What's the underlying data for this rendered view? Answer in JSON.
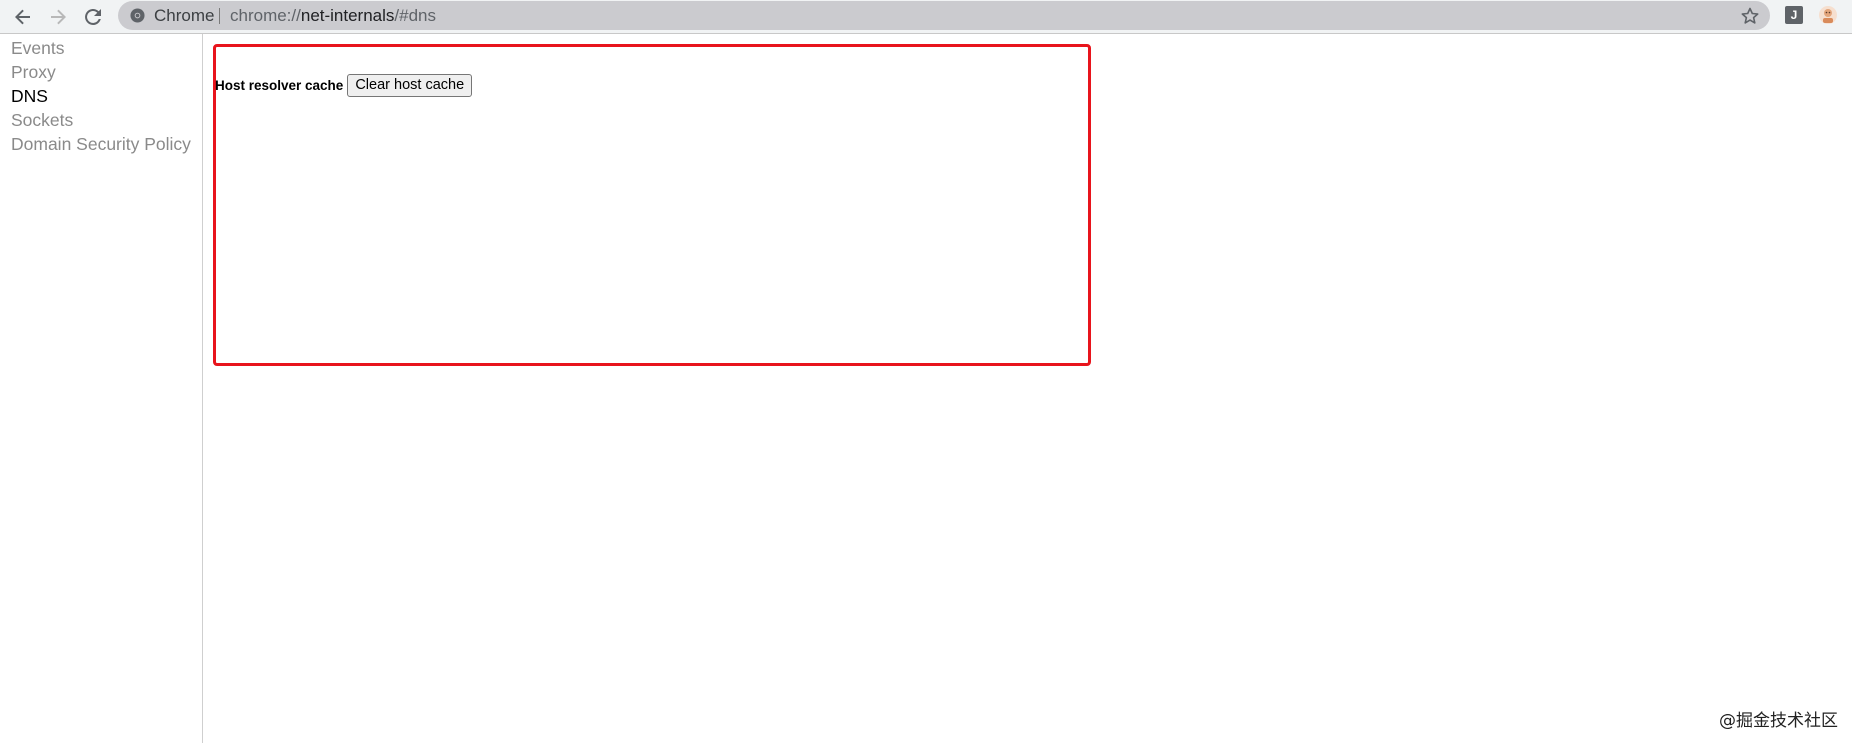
{
  "browser": {
    "site_label": "Chrome",
    "url_scheme": "chrome://",
    "url_host": "net-internals",
    "url_path": "/#dns",
    "extension_label": "J",
    "icons": [
      "back-icon",
      "forward-icon",
      "reload-icon",
      "chrome-site-icon",
      "star-icon",
      "profile-avatar-icon"
    ]
  },
  "sidebar": {
    "items": [
      {
        "label": "Events",
        "active": false
      },
      {
        "label": "Proxy",
        "active": false
      },
      {
        "label": "DNS",
        "active": true
      },
      {
        "label": "Sockets",
        "active": false
      },
      {
        "label": "Domain Security Policy",
        "active": false
      }
    ]
  },
  "dns": {
    "cache_label": "Host resolver cache",
    "clear_button": "Clear host cache"
  },
  "colors": {
    "highlight": "#e8141c",
    "inactive_nav": "#8a8a8a",
    "active_nav": "#000000"
  },
  "watermark": "@掘金技术社区"
}
